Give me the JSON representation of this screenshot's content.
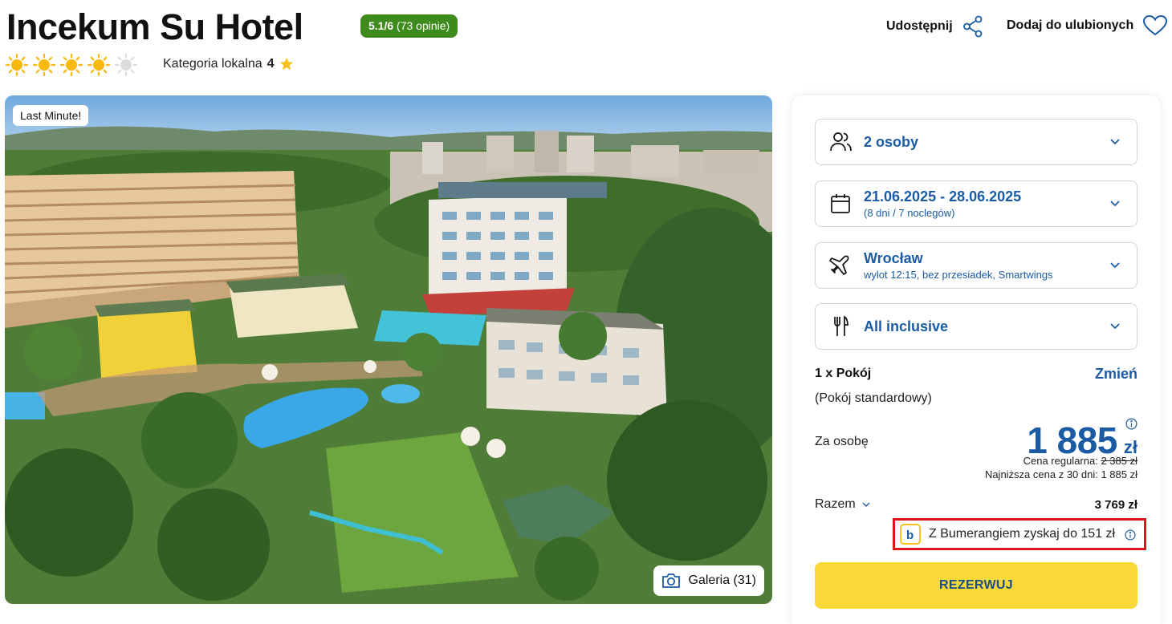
{
  "header": {
    "title": "Incekum Su Hotel",
    "rating_score": "5.1/6",
    "rating_reviews": "(73 opinie)",
    "sun_rating": 4,
    "sun_max": 5,
    "local_category_label": "Kategoria lokalna",
    "local_category_value": "4",
    "share_label": "Udostępnij",
    "favorite_label": "Dodaj do ulubionych"
  },
  "photo": {
    "badge": "Last Minute!",
    "gallery_label": "Galeria (31)"
  },
  "booking": {
    "persons": {
      "label": "2 osoby"
    },
    "dates": {
      "label": "21.06.2025 - 28.06.2025",
      "sub": "(8 dni / 7 noclegów)"
    },
    "flight": {
      "label": "Wrocław",
      "sub": "wylot 12:15, bez przesiadek, Smartwings"
    },
    "board": {
      "label": "All inclusive"
    },
    "room_title": "1 x Pokój",
    "room_change": "Zmień",
    "room_type": "(Pokój standardowy)",
    "per_person_label": "Za osobę",
    "price": "1 885",
    "currency": "zł",
    "regular_label": "Cena regularna:",
    "regular_price": "2 385 zł",
    "lowest_label": "Najniższa cena z 30 dni: 1 885 zł",
    "total_label": "Razem",
    "total_value": "3 769 zł",
    "bumerang_label": "Z Bumerangiem zyskaj do 151 zł",
    "reserve_label": "REZERWUJ"
  },
  "colors": {
    "accent_blue": "#1a5ba3",
    "rating_green": "#3f8a1c",
    "reserve_yellow": "#f9d83a",
    "highlight_red": "#e0121e"
  }
}
